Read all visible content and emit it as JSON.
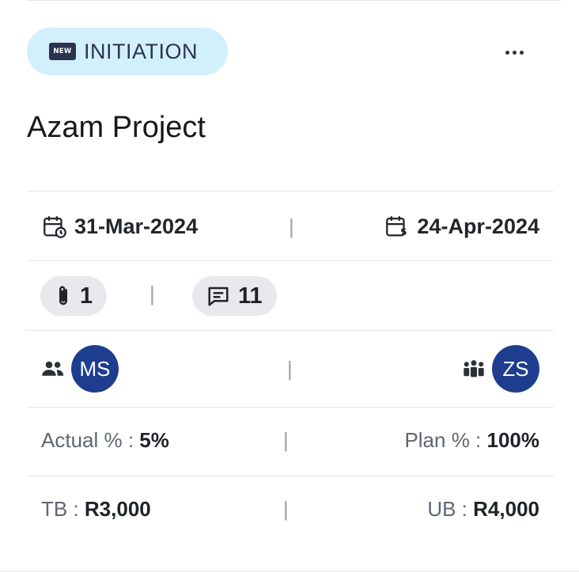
{
  "card": {
    "stage": {
      "icon_text": "NEW",
      "label": "INITIATION"
    },
    "title": "Azam Project",
    "dates": {
      "start": "31-Mar-2024",
      "end": "24-Apr-2024"
    },
    "counts": {
      "attachments": "1",
      "comments": "11"
    },
    "people": {
      "owner_initials": "MS",
      "team_initials": "ZS"
    },
    "progress": {
      "actual_label": "Actual % :",
      "actual_value": "5%",
      "plan_label": "Plan % :",
      "plan_value": "100%"
    },
    "budget": {
      "tb_label": "TB :",
      "tb_value": "R3,000",
      "ub_label": "UB :",
      "ub_value": "R4,000"
    },
    "separator": "|"
  },
  "colors": {
    "badge_bg": "#d2f0fb",
    "avatar_bg": "#1f3d8f",
    "chip_bg": "#e8e9ec"
  }
}
